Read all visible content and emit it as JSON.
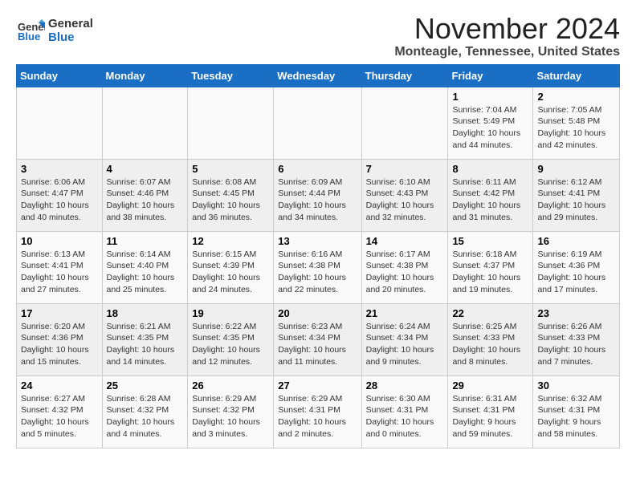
{
  "header": {
    "logo_general": "General",
    "logo_blue": "Blue",
    "title": "November 2024",
    "subtitle": "Monteagle, Tennessee, United States"
  },
  "weekdays": [
    "Sunday",
    "Monday",
    "Tuesday",
    "Wednesday",
    "Thursday",
    "Friday",
    "Saturday"
  ],
  "weeks": [
    [
      {
        "day": "",
        "info": ""
      },
      {
        "day": "",
        "info": ""
      },
      {
        "day": "",
        "info": ""
      },
      {
        "day": "",
        "info": ""
      },
      {
        "day": "",
        "info": ""
      },
      {
        "day": "1",
        "info": "Sunrise: 7:04 AM\nSunset: 5:49 PM\nDaylight: 10 hours\nand 44 minutes."
      },
      {
        "day": "2",
        "info": "Sunrise: 7:05 AM\nSunset: 5:48 PM\nDaylight: 10 hours\nand 42 minutes."
      }
    ],
    [
      {
        "day": "3",
        "info": "Sunrise: 6:06 AM\nSunset: 4:47 PM\nDaylight: 10 hours\nand 40 minutes."
      },
      {
        "day": "4",
        "info": "Sunrise: 6:07 AM\nSunset: 4:46 PM\nDaylight: 10 hours\nand 38 minutes."
      },
      {
        "day": "5",
        "info": "Sunrise: 6:08 AM\nSunset: 4:45 PM\nDaylight: 10 hours\nand 36 minutes."
      },
      {
        "day": "6",
        "info": "Sunrise: 6:09 AM\nSunset: 4:44 PM\nDaylight: 10 hours\nand 34 minutes."
      },
      {
        "day": "7",
        "info": "Sunrise: 6:10 AM\nSunset: 4:43 PM\nDaylight: 10 hours\nand 32 minutes."
      },
      {
        "day": "8",
        "info": "Sunrise: 6:11 AM\nSunset: 4:42 PM\nDaylight: 10 hours\nand 31 minutes."
      },
      {
        "day": "9",
        "info": "Sunrise: 6:12 AM\nSunset: 4:41 PM\nDaylight: 10 hours\nand 29 minutes."
      }
    ],
    [
      {
        "day": "10",
        "info": "Sunrise: 6:13 AM\nSunset: 4:41 PM\nDaylight: 10 hours\nand 27 minutes."
      },
      {
        "day": "11",
        "info": "Sunrise: 6:14 AM\nSunset: 4:40 PM\nDaylight: 10 hours\nand 25 minutes."
      },
      {
        "day": "12",
        "info": "Sunrise: 6:15 AM\nSunset: 4:39 PM\nDaylight: 10 hours\nand 24 minutes."
      },
      {
        "day": "13",
        "info": "Sunrise: 6:16 AM\nSunset: 4:38 PM\nDaylight: 10 hours\nand 22 minutes."
      },
      {
        "day": "14",
        "info": "Sunrise: 6:17 AM\nSunset: 4:38 PM\nDaylight: 10 hours\nand 20 minutes."
      },
      {
        "day": "15",
        "info": "Sunrise: 6:18 AM\nSunset: 4:37 PM\nDaylight: 10 hours\nand 19 minutes."
      },
      {
        "day": "16",
        "info": "Sunrise: 6:19 AM\nSunset: 4:36 PM\nDaylight: 10 hours\nand 17 minutes."
      }
    ],
    [
      {
        "day": "17",
        "info": "Sunrise: 6:20 AM\nSunset: 4:36 PM\nDaylight: 10 hours\nand 15 minutes."
      },
      {
        "day": "18",
        "info": "Sunrise: 6:21 AM\nSunset: 4:35 PM\nDaylight: 10 hours\nand 14 minutes."
      },
      {
        "day": "19",
        "info": "Sunrise: 6:22 AM\nSunset: 4:35 PM\nDaylight: 10 hours\nand 12 minutes."
      },
      {
        "day": "20",
        "info": "Sunrise: 6:23 AM\nSunset: 4:34 PM\nDaylight: 10 hours\nand 11 minutes."
      },
      {
        "day": "21",
        "info": "Sunrise: 6:24 AM\nSunset: 4:34 PM\nDaylight: 10 hours\nand 9 minutes."
      },
      {
        "day": "22",
        "info": "Sunrise: 6:25 AM\nSunset: 4:33 PM\nDaylight: 10 hours\nand 8 minutes."
      },
      {
        "day": "23",
        "info": "Sunrise: 6:26 AM\nSunset: 4:33 PM\nDaylight: 10 hours\nand 7 minutes."
      }
    ],
    [
      {
        "day": "24",
        "info": "Sunrise: 6:27 AM\nSunset: 4:32 PM\nDaylight: 10 hours\nand 5 minutes."
      },
      {
        "day": "25",
        "info": "Sunrise: 6:28 AM\nSunset: 4:32 PM\nDaylight: 10 hours\nand 4 minutes."
      },
      {
        "day": "26",
        "info": "Sunrise: 6:29 AM\nSunset: 4:32 PM\nDaylight: 10 hours\nand 3 minutes."
      },
      {
        "day": "27",
        "info": "Sunrise: 6:29 AM\nSunset: 4:31 PM\nDaylight: 10 hours\nand 2 minutes."
      },
      {
        "day": "28",
        "info": "Sunrise: 6:30 AM\nSunset: 4:31 PM\nDaylight: 10 hours\nand 0 minutes."
      },
      {
        "day": "29",
        "info": "Sunrise: 6:31 AM\nSunset: 4:31 PM\nDaylight: 9 hours\nand 59 minutes."
      },
      {
        "day": "30",
        "info": "Sunrise: 6:32 AM\nSunset: 4:31 PM\nDaylight: 9 hours\nand 58 minutes."
      }
    ]
  ]
}
